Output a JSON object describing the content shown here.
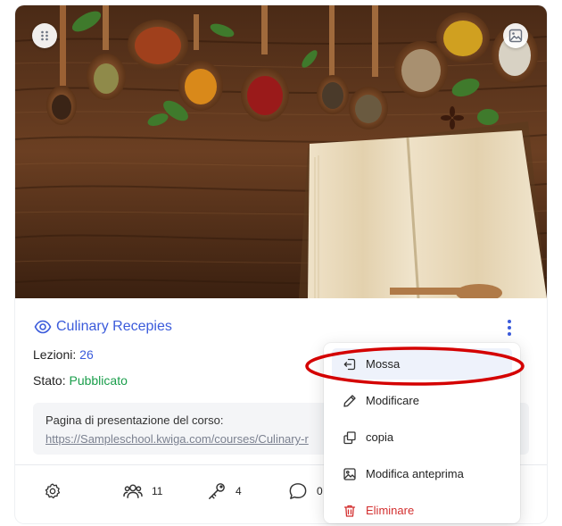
{
  "course": {
    "title": "Culinary Recepies",
    "lessons_label": "Lezioni:",
    "lessons_value": "26",
    "status_label": "Stato:",
    "status_value": "Pubblicato",
    "landing_label": "Pagina di presentazione del corso:",
    "landing_url": "https://Sampleschool.kwiga.com/courses/Culinary-r"
  },
  "footer": {
    "students_count": "11",
    "keys_count": "4",
    "comments_count": "0"
  },
  "menu": {
    "items": [
      {
        "label": "Mossa",
        "icon": "move-icon"
      },
      {
        "label": "Modificare",
        "icon": "pencil-icon"
      },
      {
        "label": "copia",
        "icon": "copy-icon"
      },
      {
        "label": "Modifica anteprima",
        "icon": "image-icon"
      },
      {
        "label": "Eliminare",
        "icon": "trash-icon"
      }
    ]
  },
  "colors": {
    "accent": "#3b5bdb",
    "status_published": "#1a9e4b",
    "danger": "#d32f2f",
    "highlight_ring": "#d40000"
  }
}
